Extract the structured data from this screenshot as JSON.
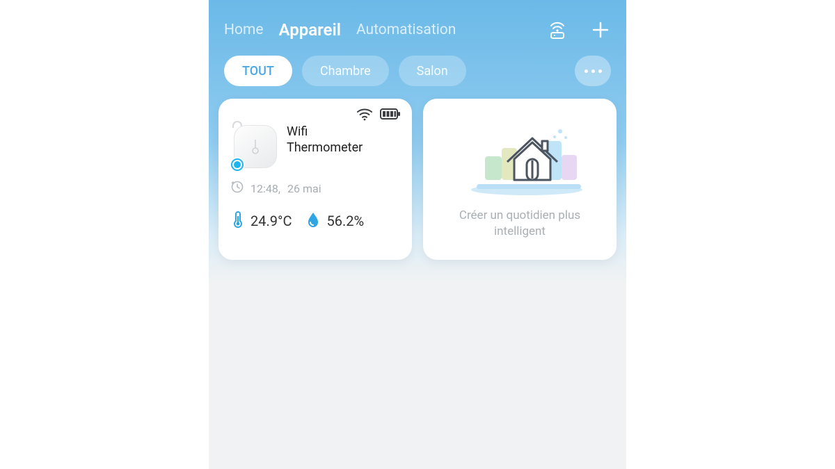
{
  "nav": {
    "home": "Home",
    "appareil": "Appareil",
    "automatisation": "Automatisation"
  },
  "filters": {
    "all": "TOUT",
    "chambre": "Chambre",
    "salon": "Salon"
  },
  "device": {
    "name_line1": "Wifi",
    "name_line2": "Thermometer",
    "time": "12:48,",
    "date": "26 mai",
    "temperature": "24.9°C",
    "humidity": "56.2%"
  },
  "promo": {
    "text": "Créer un quotidien plus intelligent"
  }
}
